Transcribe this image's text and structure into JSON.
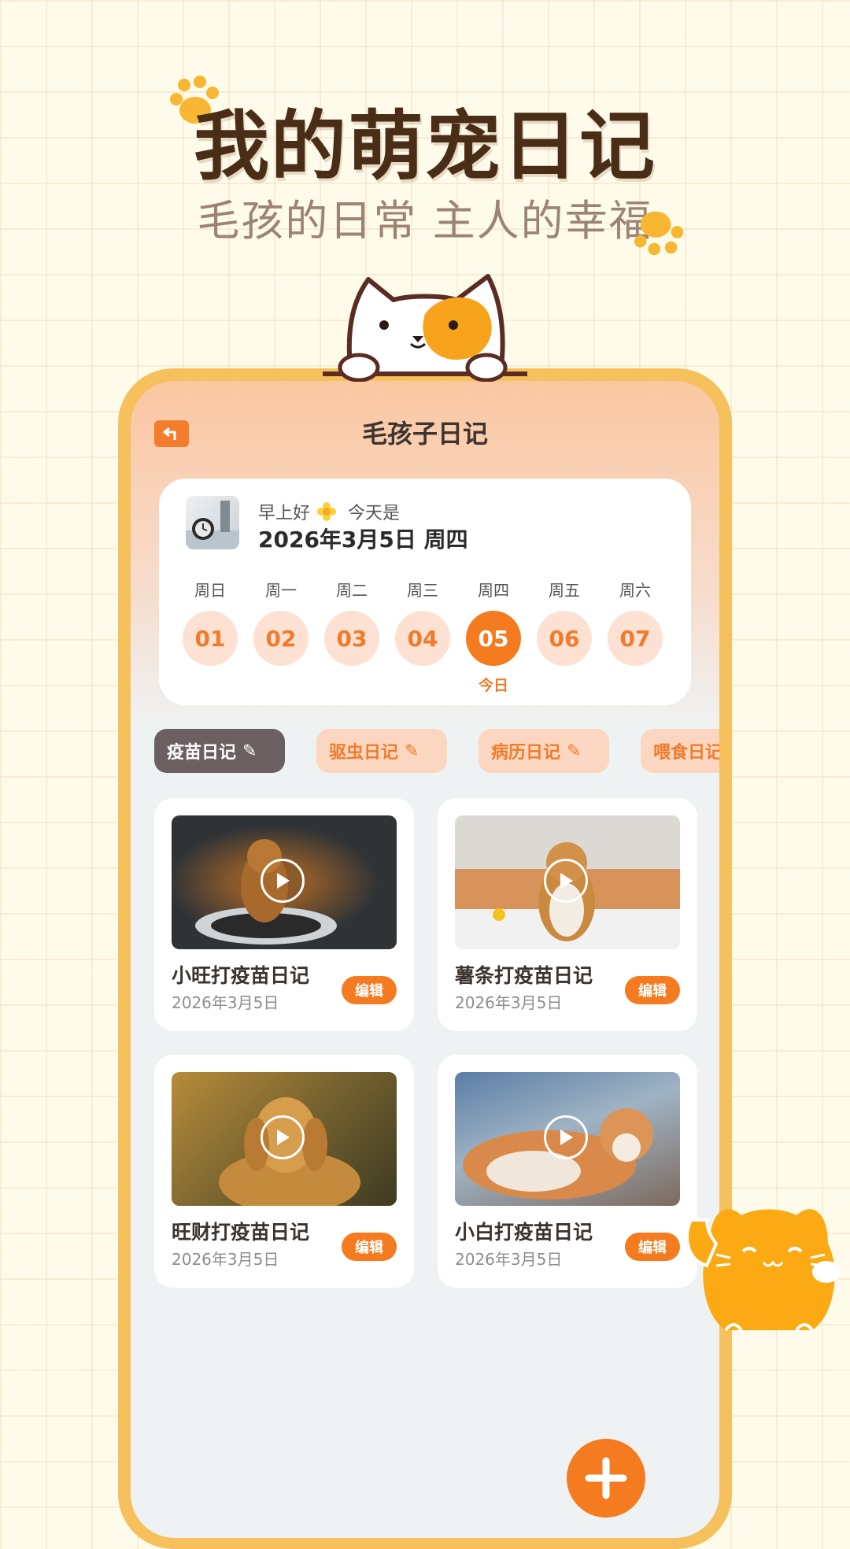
{
  "hero": {
    "title": "我的萌宠日记",
    "subtitle": "毛孩的日常   主人的幸福"
  },
  "app": {
    "nav_title": "毛孩子日记",
    "greeting": "早上好",
    "greeting_suffix": "今天是",
    "date": "2026年3月5日 周四",
    "weekdays": [
      "周日",
      "周一",
      "周二",
      "周三",
      "周四",
      "周五",
      "周六"
    ],
    "days": [
      "01",
      "02",
      "03",
      "04",
      "05",
      "06",
      "07"
    ],
    "selected_day_index": 4,
    "today_label": "今日",
    "chips": [
      "疫苗日记",
      "驱虫日记",
      "病历日记",
      "喂食日记"
    ],
    "active_chip_index": 0,
    "cards": [
      {
        "title": "小旺打疫苗日记",
        "date": "2026年3月5日",
        "edit": "编辑"
      },
      {
        "title": "薯条打疫苗日记",
        "date": "2026年3月5日",
        "edit": "编辑"
      },
      {
        "title": "旺财打疫苗日记",
        "date": "2026年3月5日",
        "edit": "编辑"
      },
      {
        "title": "小白打疫苗日记",
        "date": "2026年3月5日",
        "edit": "编辑"
      }
    ]
  },
  "colors": {
    "accent": "#f47b1f",
    "frame": "#f6c05c",
    "title_brown": "#4a2d17"
  },
  "icons": {
    "back": "back-arrow-icon",
    "play": "play-icon",
    "add": "plus-icon",
    "chip": "paw-note-icon"
  }
}
